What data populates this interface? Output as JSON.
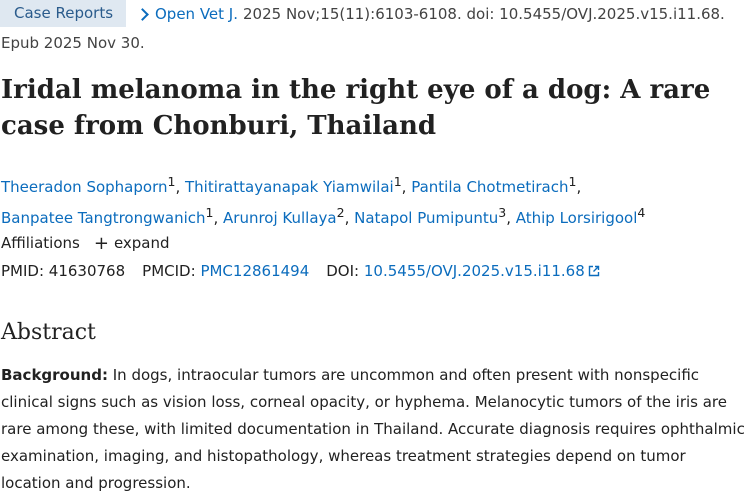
{
  "citation": {
    "type_badge": "Case Reports",
    "journal": "Open Vet J.",
    "details": "2025 Nov;15(11):6103-6108. doi: 10.5455/OVJ.2025.v15.i11.68.",
    "epub": "Epub 2025 Nov 30."
  },
  "title": "Iridal melanoma in the right eye of a dog: A rare case from Chonburi, Thailand",
  "authors": [
    {
      "name": "Theeradon Sophaporn",
      "aff": "1"
    },
    {
      "name": "Thitirattayanapak Yiamwilai",
      "aff": "1"
    },
    {
      "name": "Pantila Chotmetirach",
      "aff": "1"
    },
    {
      "name": "Banpatee Tangtrongwanich",
      "aff": "1"
    },
    {
      "name": "Arunroj Kullaya",
      "aff": "2"
    },
    {
      "name": "Natapol Pumipuntu",
      "aff": "3"
    },
    {
      "name": "Athip Lorsirigool",
      "aff": "4"
    }
  ],
  "affiliations": {
    "label": "Affiliations",
    "expand_label": "expand"
  },
  "ids": {
    "pmid_label": "PMID:",
    "pmid": "41630768",
    "pmcid_label": "PMCID:",
    "pmcid": "PMC12861494",
    "doi_label": "DOI:",
    "doi": "10.5455/OVJ.2025.v15.i11.68"
  },
  "abstract": {
    "heading": "Abstract",
    "background_label": "Background:",
    "background_text": "In dogs, intraocular tumors are uncommon and often present with nonspecific clinical signs such as vision loss, corneal opacity, or hyphema. Melanocytic tumors of the iris are rare among these, with limited documentation in Thailand. Accurate diagnosis requires ophthalmic examination, imaging, and histopathology, whereas treatment strategies depend on tumor location and progression."
  },
  "colors": {
    "link": "#0b6cbd",
    "badge_bg": "#dfe8f1",
    "badge_text": "#2a5b8c",
    "text": "#212121"
  },
  "icons": {
    "journal_chevron": "chevron-right-icon",
    "expand": "plus-icon",
    "external_link": "external-link-icon"
  }
}
